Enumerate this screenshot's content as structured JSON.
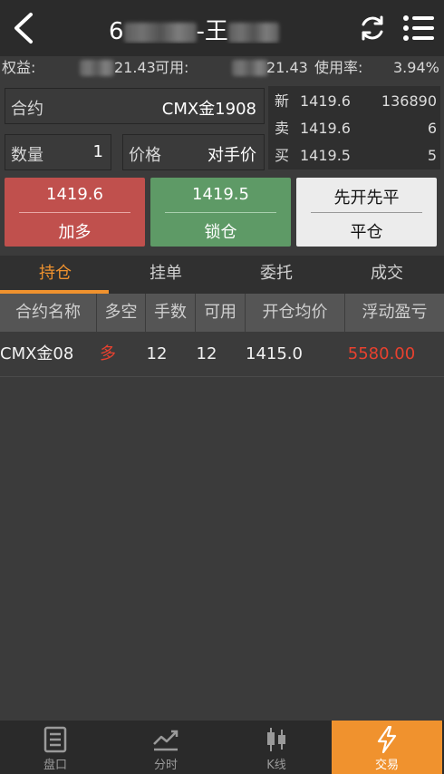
{
  "header": {
    "title_prefix": "6",
    "title_mid": "-王",
    "back_icon": "chevron-left-icon",
    "refresh_icon": "refresh-icon",
    "menu_icon": "list-menu-icon"
  },
  "account": {
    "equity_label": "权益:",
    "equity_value": "21.43",
    "available_label": "可用:",
    "available_value": "21.43",
    "usage_label": "使用率:",
    "usage_value": "3.94%"
  },
  "order_form": {
    "contract_label": "合约",
    "contract_value": "CMX金1908",
    "quantity_label": "数量",
    "quantity_value": "1",
    "price_label": "价格",
    "price_value": "对手价"
  },
  "quote": {
    "last_label": "新",
    "last_price": "1419.6",
    "last_volume": "136890",
    "ask_label": "卖",
    "ask_price": "1419.6",
    "ask_volume": "6",
    "bid_label": "买",
    "bid_price": "1419.5",
    "bid_volume": "5"
  },
  "actions": {
    "buy_price": "1419.6",
    "buy_label": "加多",
    "lock_price": "1419.5",
    "lock_label": "锁仓",
    "close_mode": "先开先平",
    "close_label": "平仓"
  },
  "tabs": [
    "持仓",
    "挂单",
    "委托",
    "成交"
  ],
  "positions": {
    "columns": [
      "合约名称",
      "多空",
      "手数",
      "可用",
      "开仓均价",
      "浮动盈亏"
    ],
    "rows": [
      {
        "name": "CMX金08",
        "direction": "多",
        "lots": "12",
        "available": "12",
        "avg_price": "1415.0",
        "pnl": "5580.00"
      }
    ]
  },
  "bottom_nav": [
    {
      "label": "盘口",
      "icon": "order-book-icon"
    },
    {
      "label": "分时",
      "icon": "intraday-chart-icon"
    },
    {
      "label": "K线",
      "icon": "candlestick-icon"
    },
    {
      "label": "交易",
      "icon": "lightning-trade-icon"
    }
  ],
  "colors": {
    "accent": "#f0922e",
    "buy": "#c0504d",
    "lock": "#5e9a66",
    "close": "#ececec",
    "loss_profit_red": "#e8412f"
  }
}
